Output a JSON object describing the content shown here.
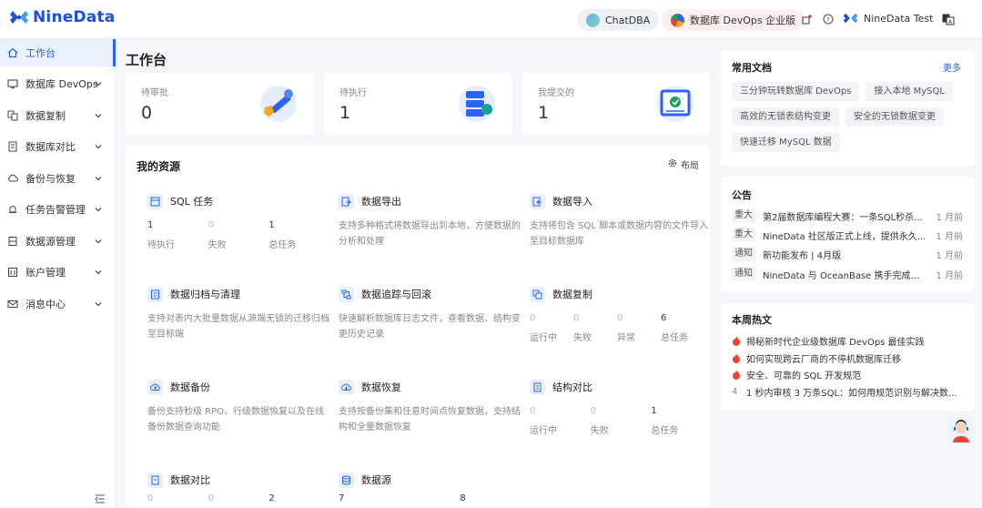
{
  "brand": {
    "name": "NineData"
  },
  "topbar": {
    "chatdba": "ChatDBA",
    "edition": "数据库 DevOps 企业版",
    "user": "NineData Test"
  },
  "sidebar": {
    "items": [
      {
        "label": "工作台",
        "icon": "home-icon",
        "active": true
      },
      {
        "label": "数据库 DevOps",
        "icon": "database-devops-icon"
      },
      {
        "label": "数据复制",
        "icon": "replicate-icon"
      },
      {
        "label": "数据库对比",
        "icon": "compare-icon"
      },
      {
        "label": "备份与恢复",
        "icon": "backup-icon"
      },
      {
        "label": "任务告警管理",
        "icon": "alarm-icon"
      },
      {
        "label": "数据源管理",
        "icon": "datasource-icon"
      },
      {
        "label": "账户管理",
        "icon": "account-icon"
      },
      {
        "label": "消息中心",
        "icon": "mail-icon"
      }
    ]
  },
  "main": {
    "title": "工作台",
    "stats": [
      {
        "label": "待审批",
        "value": "0"
      },
      {
        "label": "待执行",
        "value": "1"
      },
      {
        "label": "我提交的",
        "value": "1"
      }
    ],
    "resources": {
      "title": "我的资源",
      "layout_label": "布局",
      "cards": [
        {
          "title": "SQL 任务",
          "stats": [
            {
              "value": "1",
              "label": "待执行"
            },
            {
              "value": "0",
              "label": "失败"
            },
            {
              "value": "1",
              "label": "总任务"
            }
          ]
        },
        {
          "title": "数据导出",
          "desc": "支持多种格式将数据导出到本地，方便数据的分析和处理"
        },
        {
          "title": "数据导入",
          "desc": "支持将包含 SQL 脚本或数据内容的文件导入至目标数据库"
        },
        {
          "title": "数据归档与清理",
          "desc": "支持对表内大批量数据从源端无锁的迁移归档至目标端"
        },
        {
          "title": "数据追踪与回滚",
          "desc": "快速解析数据库日志文件，查看数据、结构变更历史记录"
        },
        {
          "title": "数据复制",
          "stats": [
            {
              "value": "0",
              "label": "运行中"
            },
            {
              "value": "0",
              "label": "失败"
            },
            {
              "value": "0",
              "label": "异常"
            },
            {
              "value": "6",
              "label": "总任务"
            }
          ]
        },
        {
          "title": "数据备份",
          "desc": "备份支持秒级 RPO、行级数据恢复以及在线备份数据查询功能"
        },
        {
          "title": "数据恢复",
          "desc": "支持按备份集和任意时间点恢复数据，支持结构和全量数据恢复"
        },
        {
          "title": "结构对比",
          "stats": [
            {
              "value": "0",
              "label": "运行中"
            },
            {
              "value": "0",
              "label": "失败"
            },
            {
              "value": "1",
              "label": "总任务"
            }
          ]
        },
        {
          "title": "数据对比",
          "stats": [
            {
              "value": "0",
              "label": ""
            },
            {
              "value": "0",
              "label": ""
            },
            {
              "value": "2",
              "label": ""
            }
          ]
        },
        {
          "title": "数据源",
          "stats": [
            {
              "value": "7",
              "label": ""
            },
            {
              "value": "",
              "label": ""
            },
            {
              "value": "8",
              "label": ""
            }
          ]
        }
      ]
    }
  },
  "docs": {
    "title": "常用文档",
    "more": "更多",
    "items": [
      "三分钟玩转数据库 DevOps",
      "接入本地 MySQL",
      "高效的无锁表结构变更",
      "安全的无锁数据变更",
      "快速迁移 MySQL 数据"
    ]
  },
  "notices": {
    "title": "公告",
    "items": [
      {
        "badge": "重大",
        "text": "第2届数据库编程大赛：一条SQL秒杀...",
        "date": "1 月前"
      },
      {
        "badge": "重大",
        "text": "NineData 社区版正式上线，提供永久...",
        "date": "1 月前"
      },
      {
        "badge": "通知",
        "text": "新功能发布 | 4月版",
        "date": "1 月前"
      },
      {
        "badge": "通知",
        "text": "NineData 与 OceanBase 携手完成产...",
        "date": "1 月前"
      }
    ]
  },
  "hot": {
    "title": "本周热文",
    "items": [
      {
        "rank": "1",
        "text": "揭秘新时代企业级数据库 DevOps 最佳实践"
      },
      {
        "rank": "2",
        "text": "如何实现跨云厂商的不停机数据库迁移"
      },
      {
        "rank": "3",
        "text": "安全、可靠的 SQL 开发规范"
      },
      {
        "rank": "4",
        "text": "1 秒内审核 3 万条SQL：如何用规范识别与解决数..."
      }
    ]
  },
  "colors": {
    "accent": "#2b63f5",
    "fire": "#e8452c"
  }
}
